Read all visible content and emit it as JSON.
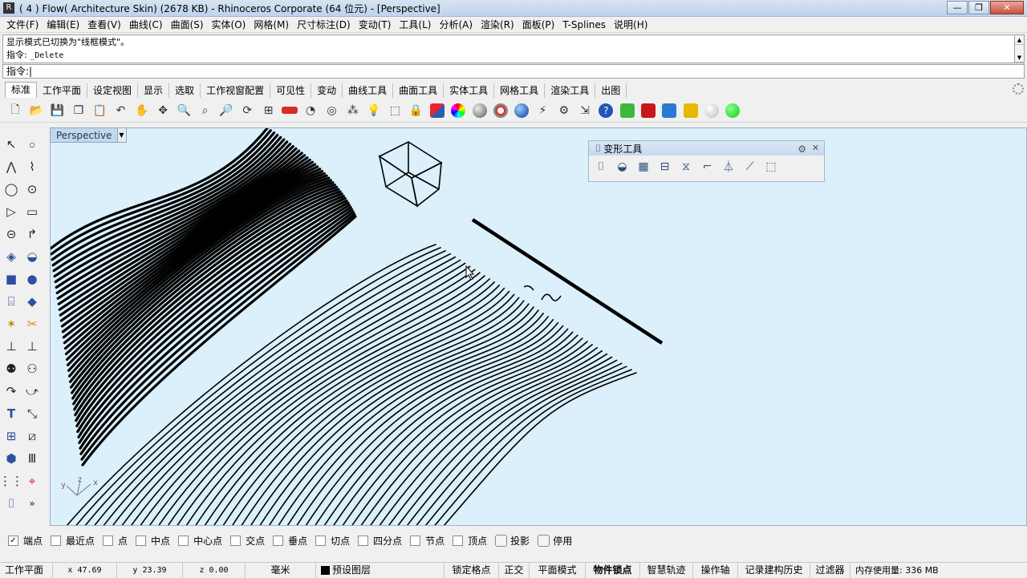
{
  "window": {
    "title": "( 4 ) Flow( Architecture Skin) (2678 KB) - Rhinoceros Corporate (64 位元) - [Perspective]",
    "buttons": [
      "—",
      "❐",
      "✕"
    ]
  },
  "menu": [
    "文件(F)",
    "编辑(E)",
    "查看(V)",
    "曲线(C)",
    "曲面(S)",
    "实体(O)",
    "网格(M)",
    "尺寸标注(D)",
    "变动(T)",
    "工具(L)",
    "分析(A)",
    "渲染(R)",
    "面板(P)",
    "T-Splines",
    "说明(H)"
  ],
  "command_history": {
    "line1": "显示模式已切换为\"线框模式\"。",
    "line2_label": "指令:",
    "line2_cmd": "_Delete"
  },
  "command_prompt": "指令:",
  "tabs": [
    "标准",
    "工作平面",
    "设定视图",
    "显示",
    "选取",
    "工作视窗配置",
    "可见性",
    "变动",
    "曲线工具",
    "曲面工具",
    "实体工具",
    "网格工具",
    "渲染工具",
    "出图"
  ],
  "toolbar_icons": [
    "new-file-icon",
    "open-file-icon",
    "save-icon",
    "copy-icon",
    "paste-icon",
    "undo-icon",
    "pan-hand-icon",
    "move-view-icon",
    "zoom-icon",
    "zoom-window-icon",
    "zoom-extents-icon",
    "rotate-view-icon",
    "four-viewports-icon",
    "car-icon",
    "hide-icon",
    "show-icon",
    "lock-icon",
    "lightbulb-icon",
    "select-icon",
    "padlock-icon",
    "layer-icon",
    "color-wheel-icon",
    "material-sphere-icon",
    "target-icon",
    "render-sphere-icon",
    "light-icon",
    "settings-gear-icon",
    "grasshopper-icon",
    "help-icon",
    "green-plugin-icon",
    "red-plugin-icon",
    "blue-plugin-icon",
    "yellow-plugin-icon",
    "white-sphere-icon",
    "green-sphere-icon"
  ],
  "viewport": {
    "name": "Perspective",
    "axis_labels": [
      "y",
      "z",
      "x"
    ]
  },
  "float_panel": {
    "title": "变形工具",
    "icons": [
      "bend-icon",
      "twist-icon",
      "cage-icon",
      "stretch-icon",
      "taper-icon",
      "flow-curve-icon",
      "splop-icon",
      "maelstrom-icon",
      "cage-edit-icon"
    ]
  },
  "osnaps": [
    {
      "label": "端点",
      "checked": true
    },
    {
      "label": "最近点",
      "checked": false
    },
    {
      "label": "点",
      "checked": false
    },
    {
      "label": "中点",
      "checked": false
    },
    {
      "label": "中心点",
      "checked": false
    },
    {
      "label": "交点",
      "checked": false
    },
    {
      "label": "垂点",
      "checked": false
    },
    {
      "label": "切点",
      "checked": false
    },
    {
      "label": "四分点",
      "checked": false
    },
    {
      "label": "节点",
      "checked": false
    },
    {
      "label": "顶点",
      "checked": false
    }
  ],
  "osnap_toggles": [
    "投影",
    "停用"
  ],
  "status": {
    "cplane": "工作平面",
    "x": "x 47.69",
    "y": "y 23.39",
    "z": "z 0.00",
    "units": "毫米",
    "layer": "预设图层",
    "grid_snap": "锁定格点",
    "ortho": "正交",
    "planar": "平面模式",
    "osnap": "物件锁点",
    "smart_track": "智慧轨迹",
    "gumball": "操作轴",
    "history": "记录建构历史",
    "filter": "过滤器",
    "memory": "内存使用量: 336 MB"
  }
}
